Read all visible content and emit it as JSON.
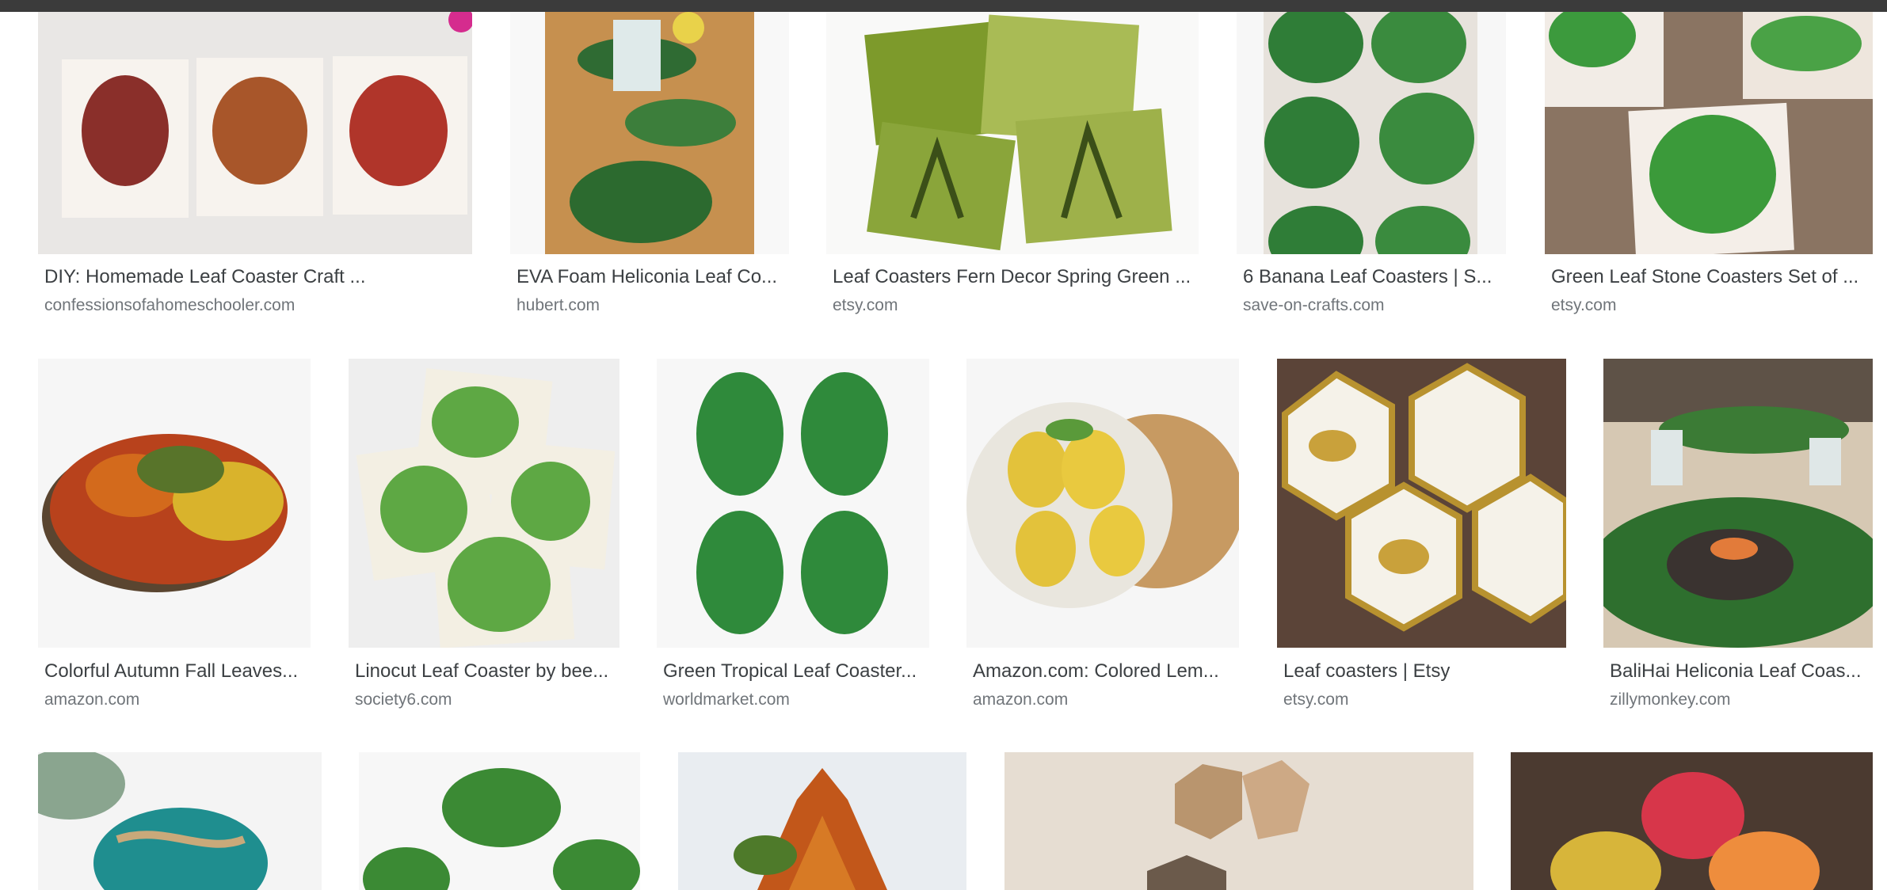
{
  "results": {
    "row1": [
      {
        "title": "DIY: Homemade Leaf Coaster Craft ...",
        "source": "confessionsofahomeschooler.com",
        "image": "autumn-leaf-tile-coasters"
      },
      {
        "title": "EVA Foam Heliconia Leaf Co...",
        "source": "hubert.com",
        "image": "heliconia-leaf-coasters-table"
      },
      {
        "title": "Leaf Coasters Fern Decor Spring Green ...",
        "source": "etsy.com",
        "image": "fern-square-coasters"
      },
      {
        "title": "6 Banana Leaf Coasters | S...",
        "source": "save-on-crafts.com",
        "image": "banana-leaf-coasters"
      },
      {
        "title": "Green Leaf Stone Coasters Set of ...",
        "source": "etsy.com",
        "image": "leaf-stone-coasters"
      }
    ],
    "row2": [
      {
        "title": "Colorful Autumn Fall Leaves...",
        "source": "amazon.com",
        "image": "autumn-leaves-round-coasters"
      },
      {
        "title": "Linocut Leaf Coaster by bee...",
        "source": "society6.com",
        "image": "linocut-monstera-coasters"
      },
      {
        "title": "Green Tropical Leaf Coaster...",
        "source": "worldmarket.com",
        "image": "tropical-leaf-coasters"
      },
      {
        "title": "Amazon.com: Colored Lem...",
        "source": "amazon.com",
        "image": "lemon-cork-coasters"
      },
      {
        "title": "Leaf coasters | Etsy",
        "source": "etsy.com",
        "image": "gold-hexagon-coasters"
      },
      {
        "title": "BaliHai Heliconia Leaf Coas...",
        "source": "zillymonkey.com",
        "image": "heliconia-table-setting"
      }
    ],
    "row3": [
      {
        "image": "teal-stone-twine"
      },
      {
        "image": "monstera-leaf-coasters"
      },
      {
        "image": "maple-leaf-coasters"
      },
      {
        "image": "hexagon-cork-box"
      },
      {
        "image": "crochet-leaf-coasters"
      }
    ]
  },
  "colors": {
    "title_text": "#3c4043",
    "source_text": "#70757a",
    "topbar": "#3b3b3b",
    "leaf_green": "#2e7d32",
    "autumn_orange": "#c2571a"
  }
}
